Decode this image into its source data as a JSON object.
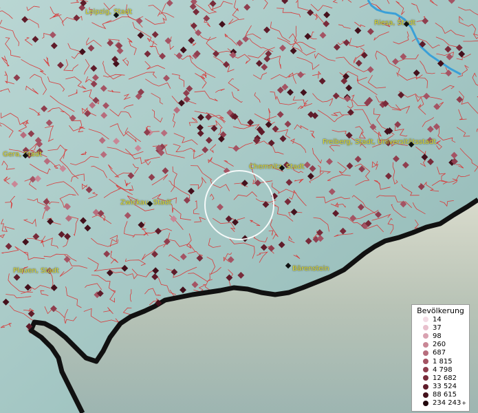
{
  "map": {
    "cities": [
      {
        "name": "Leipzig, Stadt"
      },
      {
        "name": "Riesa, Stadt"
      },
      {
        "name": "Gera, Stadt"
      },
      {
        "name": "Chemnitz, Stadt"
      },
      {
        "name": "Freiberg, Stadt, Universitätsstadt"
      },
      {
        "name": "Zwickau, Stadt"
      },
      {
        "name": "Plauen, Stadt"
      },
      {
        "name": "Bärenstein"
      }
    ],
    "colors": {
      "boundary": "#d83a3a",
      "river": "#3aa0d8",
      "border": "#111111",
      "label": "#e0e030"
    }
  },
  "legend": {
    "title": "Bevölkerung",
    "items": [
      {
        "label": "14",
        "color": "#f3dce5"
      },
      {
        "label": "37",
        "color": "#e8c0cd"
      },
      {
        "label": "98",
        "color": "#d9a2b1"
      },
      {
        "label": "260",
        "color": "#c98796"
      },
      {
        "label": "687",
        "color": "#b76d7d"
      },
      {
        "label": "1 815",
        "color": "#a45464"
      },
      {
        "label": "4 798",
        "color": "#8f3e4e"
      },
      {
        "label": "12 682",
        "color": "#782b3a"
      },
      {
        "label": "33 524",
        "color": "#5f1c2a"
      },
      {
        "label": "88 615",
        "color": "#44111c"
      },
      {
        "label": "234 243",
        "color": "#22070d",
        "suffix": "+"
      }
    ]
  }
}
